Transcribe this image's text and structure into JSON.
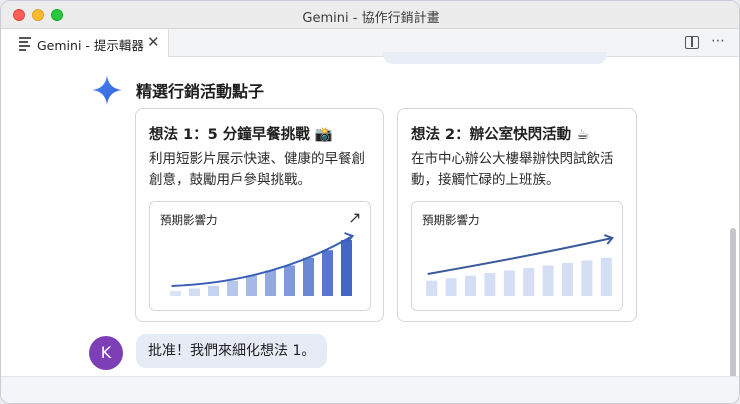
{
  "window": {
    "title": "Gemini - 協作行銷計畫"
  },
  "tab": {
    "label": "Gemini - 提示輯器",
    "close": "✕"
  },
  "toolbar": {
    "more": "⋯"
  },
  "response": {
    "heading": "精選行銷活動點子",
    "ideas": [
      {
        "title": "想法 1：5 分鐘早餐挑戰",
        "emoji": "📸",
        "description": "利用短影片展示快速、健康的早餐創創意，鼓勵用戶參與挑戰。",
        "chart_label": "預期影響力",
        "arrow": "↗"
      },
      {
        "title": "想法 2：辦公室快閃活動",
        "emoji": "☕",
        "description": "在市中心辦公大樓舉辦快閃試飲活動，接觸忙碌的上班族。",
        "chart_label": "預期影響力"
      }
    ]
  },
  "user": {
    "avatar_initial": "K",
    "message": "批准！我們來細化想法 1。"
  },
  "chart_data": [
    {
      "type": "bar",
      "title": "預期影響力",
      "values": [
        1,
        1.5,
        2,
        3,
        4,
        5,
        6,
        7.5,
        9,
        11
      ],
      "trend": "up",
      "colors": [
        "#dbe4f5",
        "#d3ddf3",
        "#c6d3ef",
        "#b7c7eb",
        "#a6b9e6",
        "#93aae1",
        "#7f99db",
        "#6a88d4",
        "#5677cd",
        "#4467c6"
      ]
    },
    {
      "type": "bar",
      "title": "預期影響力",
      "values": [
        3,
        3.5,
        4,
        4.5,
        5,
        5.5,
        6,
        6.5,
        7,
        7.5
      ],
      "trend": "up",
      "colors": [
        "#d4def4"
      ]
    }
  ]
}
